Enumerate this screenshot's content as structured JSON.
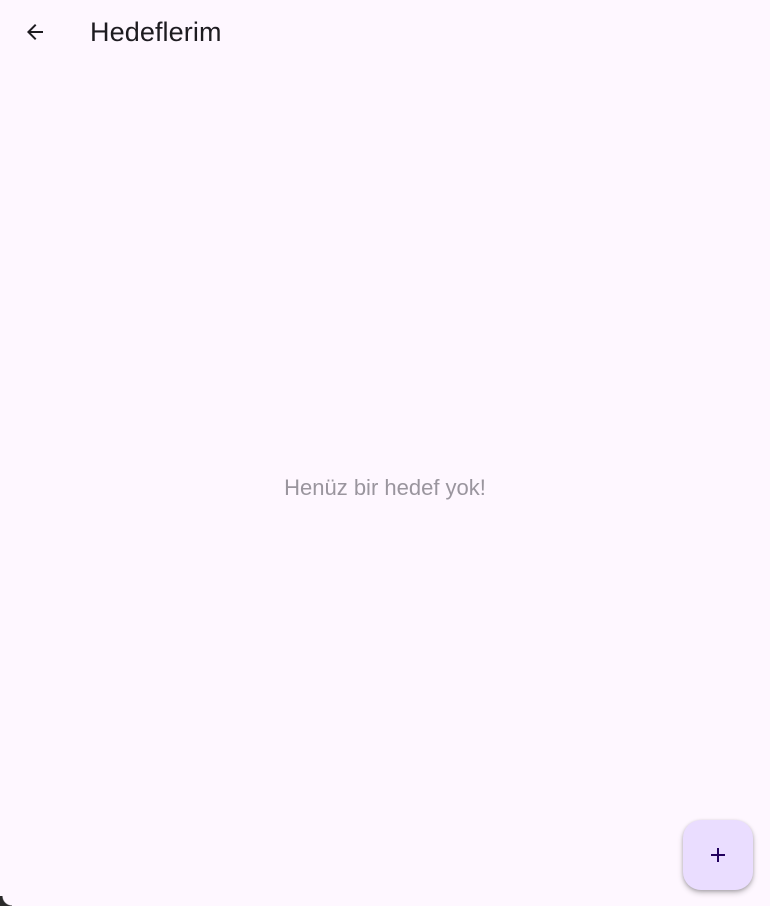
{
  "app_bar": {
    "title": "Hedeflerim",
    "back_icon": "arrow-back-icon"
  },
  "main": {
    "empty_message": "Henüz bir hedef yok!"
  },
  "fab": {
    "icon": "add-icon"
  },
  "colors": {
    "background": "#fef7ff",
    "title_text": "#1d1b20",
    "empty_text": "#9a959e",
    "fab_background": "#eaddff",
    "fab_icon": "#21005d"
  }
}
